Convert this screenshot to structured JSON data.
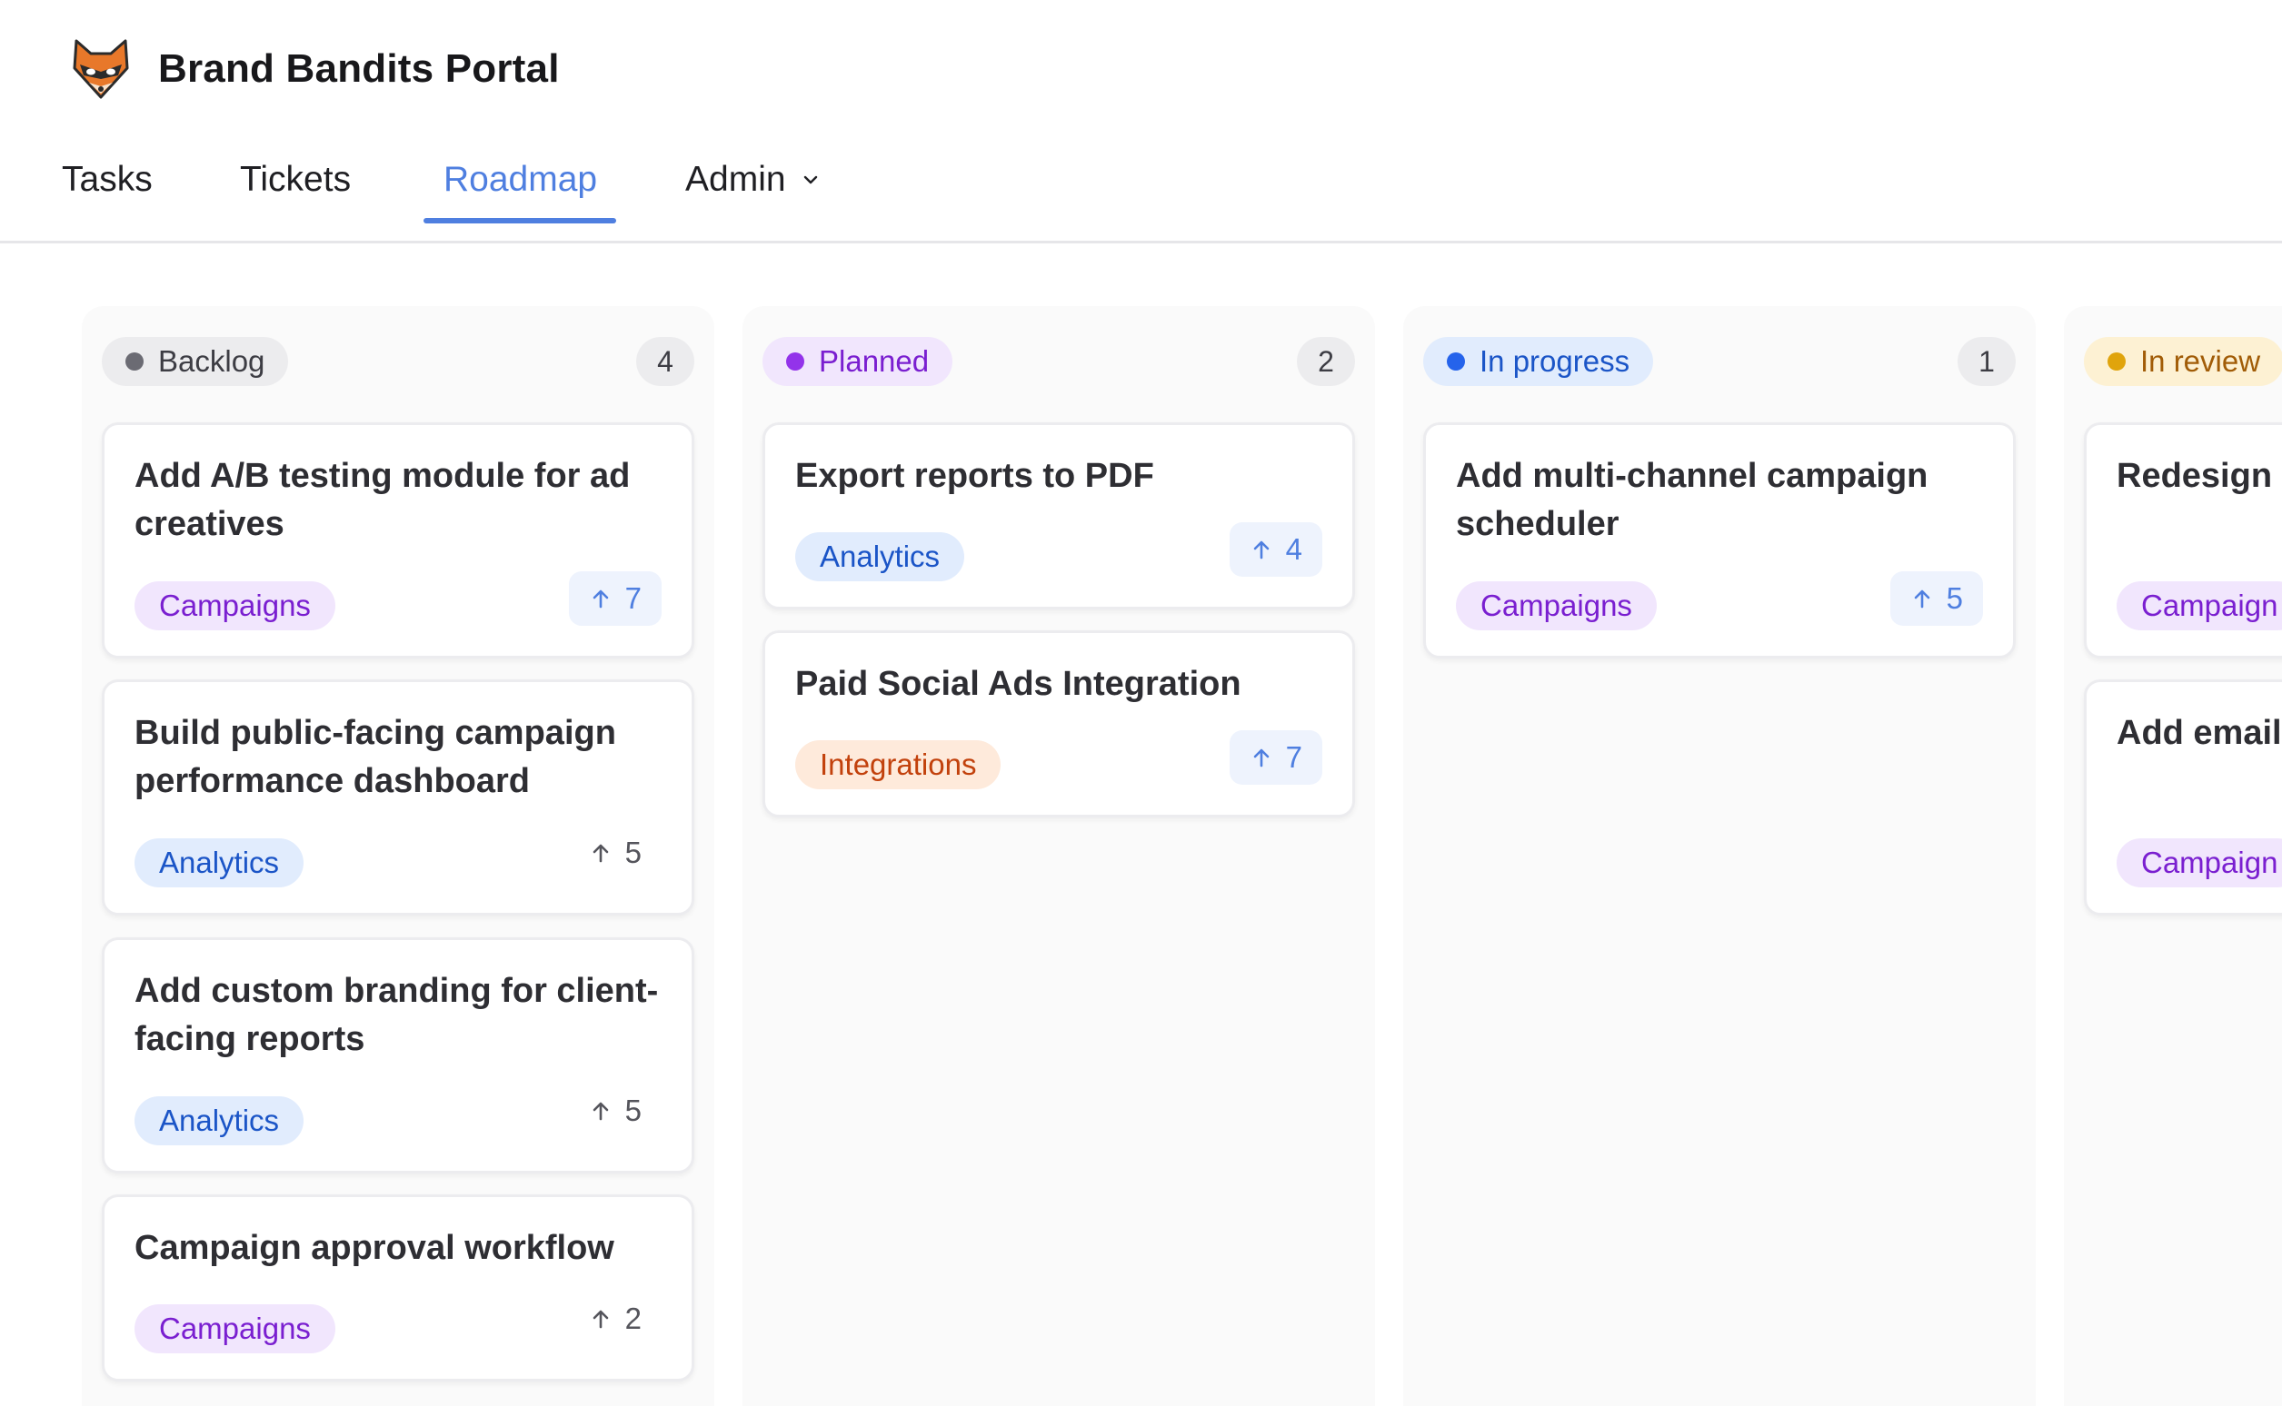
{
  "app": {
    "title": "Brand Bandits Portal",
    "logo_icon": "fox-mask-icon"
  },
  "nav": {
    "tabs": [
      {
        "label": "Tasks",
        "active": false
      },
      {
        "label": "Tickets",
        "active": false
      },
      {
        "label": "Roadmap",
        "active": true
      },
      {
        "label": "Admin",
        "active": false,
        "has_dropdown": true
      }
    ]
  },
  "colors": {
    "accent": "#4f7fe0",
    "backlog": "#6b6b73",
    "planned": "#9333ea",
    "in_progress": "#2563eb",
    "in_review": "#e0a40c"
  },
  "columns": [
    {
      "status": "Backlog",
      "count": "4",
      "cards": [
        {
          "title": "Add A/B testing module for ad creatives",
          "tag": "Campaigns",
          "votes": "7",
          "voted": true
        },
        {
          "title": "Build public-facing campaign performance dashboard",
          "tag": "Analytics",
          "votes": "5",
          "voted": false
        },
        {
          "title": "Add custom branding for client-facing reports",
          "tag": "Analytics",
          "votes": "5",
          "voted": false
        },
        {
          "title": "Campaign approval workflow",
          "tag": "Campaigns",
          "votes": "2",
          "voted": false
        }
      ]
    },
    {
      "status": "Planned",
      "count": "2",
      "cards": [
        {
          "title": "Export reports to PDF",
          "tag": "Analytics",
          "votes": "4",
          "voted": true
        },
        {
          "title": "Paid Social Ads Integration",
          "tag": "Integrations",
          "votes": "7",
          "voted": true
        }
      ]
    },
    {
      "status": "In progress",
      "count": "1",
      "cards": [
        {
          "title": "Add multi-channel campaign scheduler",
          "tag": "Campaigns",
          "votes": "5",
          "voted": true
        }
      ]
    },
    {
      "status": "In review",
      "cards": [
        {
          "title": "Redesign c flow",
          "tag": "Campaign"
        },
        {
          "title": "Add email campaign",
          "tag": "Campaign"
        }
      ]
    }
  ]
}
